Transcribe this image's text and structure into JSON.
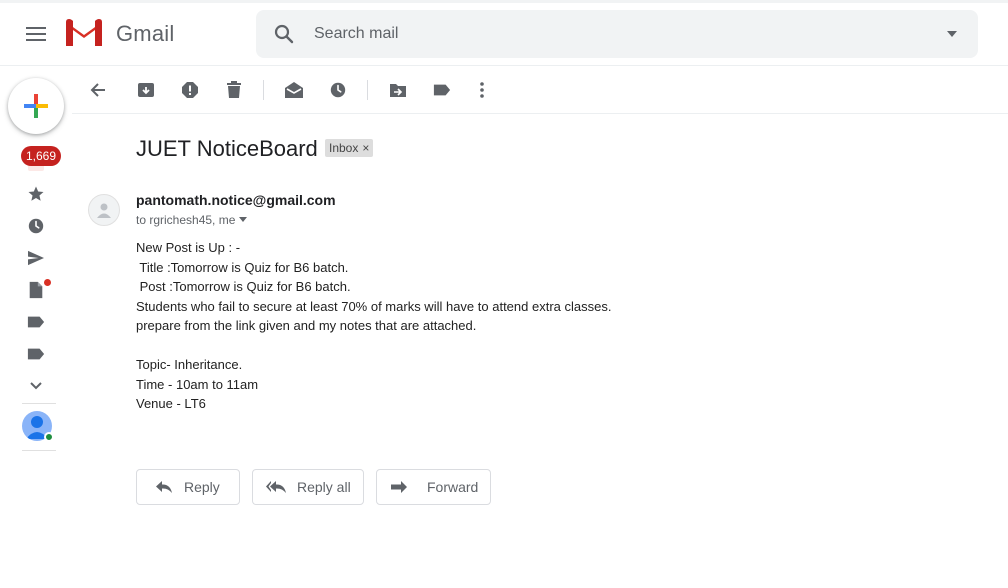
{
  "app": {
    "brand": "Gmail",
    "menu_icon": "hamburger-menu-icon",
    "logo_icon": "gmail-logo-icon"
  },
  "search": {
    "placeholder": "Search mail",
    "value": "",
    "icon": "search-icon",
    "options_icon": "caret-down-icon"
  },
  "rail": {
    "compose_icon": "plus-icon",
    "inbox_count": "1,669",
    "items": [
      {
        "name": "inbox",
        "icon": "inbox-icon"
      },
      {
        "name": "starred",
        "icon": "star-icon"
      },
      {
        "name": "snoozed",
        "icon": "clock-icon"
      },
      {
        "name": "sent",
        "icon": "send-icon"
      },
      {
        "name": "drafts",
        "icon": "draft-icon"
      },
      {
        "name": "label-1",
        "icon": "label-icon"
      },
      {
        "name": "label-2",
        "icon": "label-icon"
      },
      {
        "name": "more",
        "icon": "chevron-down-icon"
      }
    ],
    "status_colors": {
      "badge": "#c5221f",
      "drafts_dot": "#d93025",
      "online": "#1e8e3e"
    }
  },
  "toolbar": {
    "items": [
      "back",
      "archive",
      "report-spam",
      "delete",
      "mark-unread",
      "snooze",
      "move-to",
      "labels",
      "more"
    ]
  },
  "message": {
    "subject": "JUET NoticeBoard",
    "label": "Inbox",
    "label_remove": "×",
    "sender": "pantomath.notice@gmail.com",
    "recipients": "to rgrichesh45, me",
    "body": [
      "New Post is Up : -",
      " Title :Tomorrow is Quiz for B6 batch.",
      " Post :Tomorrow is Quiz for B6 batch.",
      "Students who fail to secure at least 70% of marks will have to attend extra classes.",
      "prepare from the link given and my notes that are attached.",
      "",
      "Topic- Inheritance.",
      "Time - 10am to 11am",
      "Venue - LT6"
    ]
  },
  "actions": {
    "reply": "Reply",
    "reply_all": "Reply all",
    "forward": "Forward"
  }
}
